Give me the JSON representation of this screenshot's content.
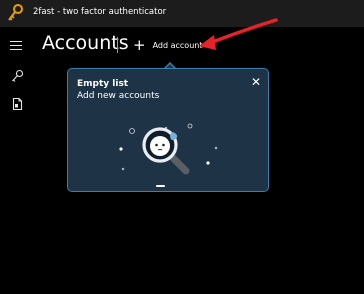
{
  "titlebar": {
    "title": "2fast - two factor authenticator",
    "icon": "key-app-icon"
  },
  "commandbar": {
    "menu_icon": "hamburger-icon",
    "page_title": "Accounts",
    "separator": "|",
    "add_icon": "plus-icon",
    "add_label": "Add account",
    "annotation": "red-arrow-pointing-to-add-account"
  },
  "nav": {
    "items": [
      {
        "icon": "key-icon"
      },
      {
        "icon": "file-icon"
      }
    ]
  },
  "tip": {
    "title": "Empty list",
    "subtitle": "Add new accounts",
    "close_icon": "close-icon",
    "illustration": "magnifier-empty-illustration",
    "border_color": "#3a7fae",
    "background_color": "#1e3345"
  },
  "colors": {
    "titlebar_bg": "#1c1c1c",
    "background": "#000000",
    "annotation_arrow": "#e8222a"
  }
}
